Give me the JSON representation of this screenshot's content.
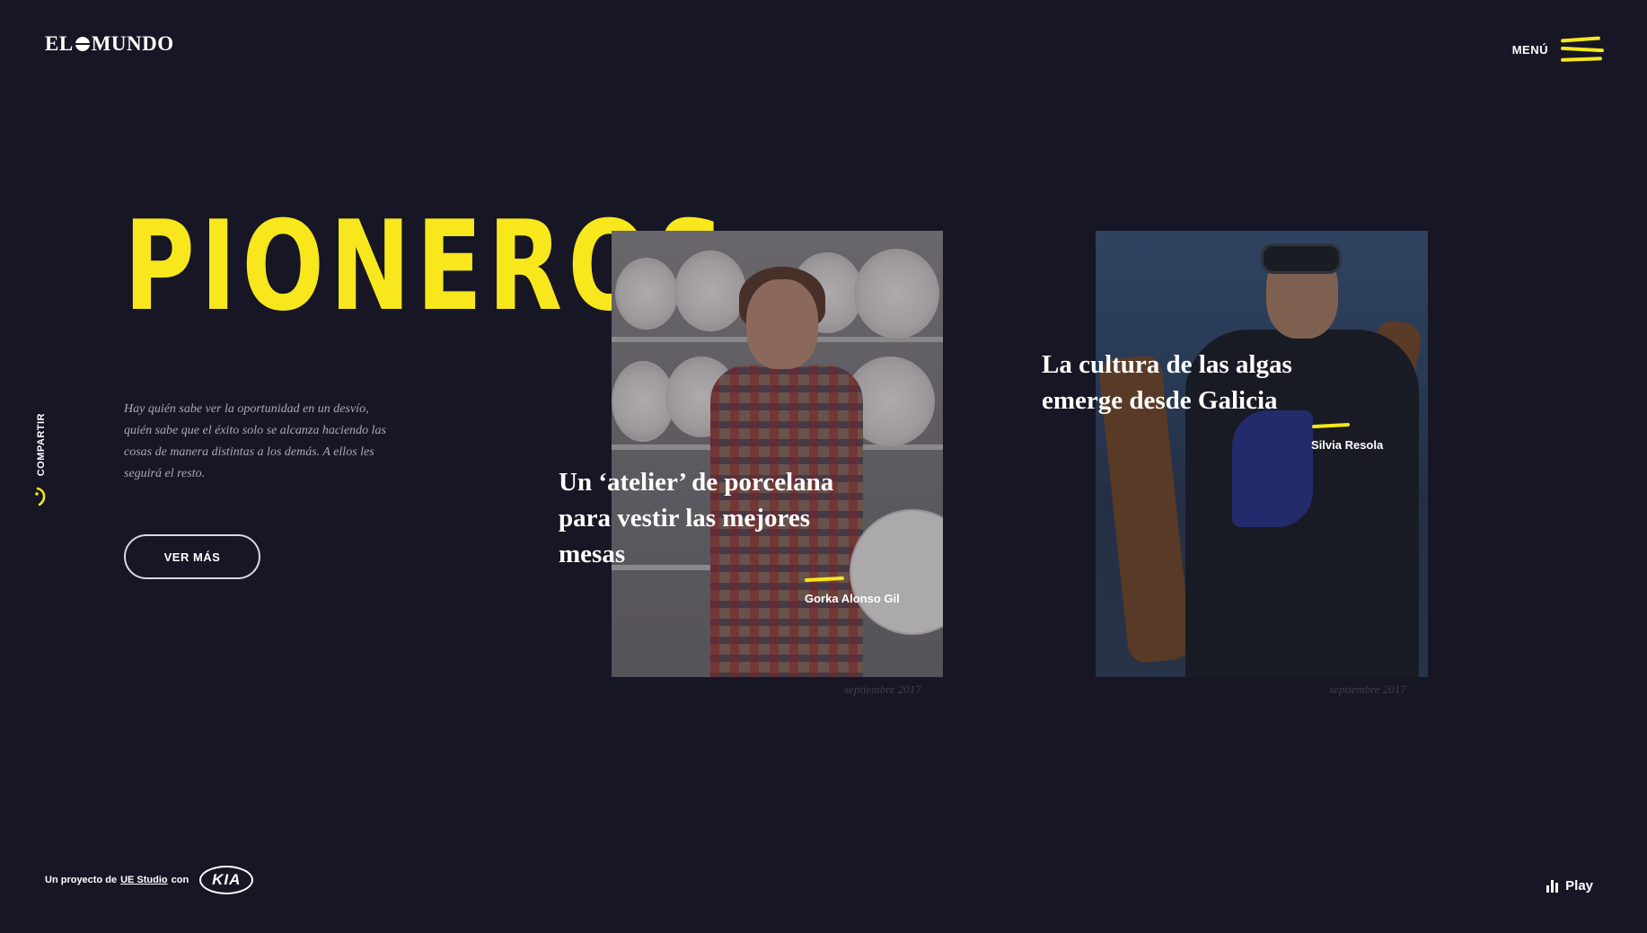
{
  "header": {
    "logo_left": "EL",
    "logo_right": "MUNDO",
    "menu_label": "MENÚ"
  },
  "share": {
    "label": "COMPARTIR"
  },
  "hero": {
    "title": "PIONEROS",
    "description": "Hay quién sabe ver la oportunidad en un desvío, quién sabe que el éxito solo se alcanza haciendo las cosas de manera distintas a los demás. A ellos les seguirá el resto.",
    "button_label": "VER MÁS"
  },
  "cards": [
    {
      "title": "Un ‘atelier’ de porcelana para vestir las mejores mesas",
      "author": "Gorka Alonso Gil",
      "date": "septiembre 2017"
    },
    {
      "title": "La cultura de las algas emerge desde Galicia",
      "author": "Silvia Resola",
      "date": "septiembre 2017"
    }
  ],
  "footer": {
    "credit_prefix": "Un proyecto de",
    "credit_link": "UE Studio",
    "credit_mid": "con",
    "sponsor": "KIA",
    "play_label": "Play"
  },
  "colors": {
    "background": "#161625",
    "accent": "#f7e71c"
  }
}
